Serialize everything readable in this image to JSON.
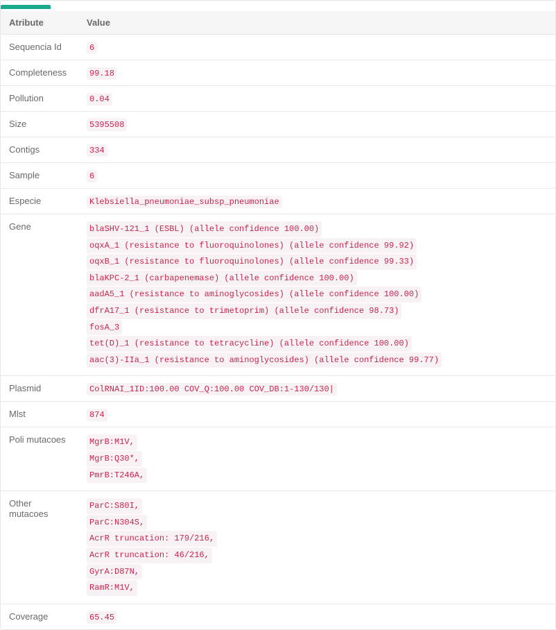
{
  "headers": {
    "attribute": "Atribute",
    "value": "Value"
  },
  "rows": [
    {
      "attr": "Sequencia Id",
      "values": [
        "6"
      ]
    },
    {
      "attr": "Completeness",
      "values": [
        "99.18"
      ]
    },
    {
      "attr": "Pollution",
      "values": [
        "0.04"
      ]
    },
    {
      "attr": "Size",
      "values": [
        "5395508"
      ]
    },
    {
      "attr": "Contigs",
      "values": [
        "334"
      ]
    },
    {
      "attr": "Sample",
      "values": [
        "6"
      ]
    },
    {
      "attr": "Especie",
      "values": [
        "Klebsiella_pneumoniae_subsp_pneumoniae"
      ]
    },
    {
      "attr": "Gene",
      "values": [
        "blaSHV-121_1 (ESBL) (allele confidence 100.00)",
        "oqxA_1 (resistance to fluoroquinolones) (allele confidence 99.92)",
        "oqxB_1 (resistance to fluoroquinolones) (allele confidence 99.33)",
        "blaKPC-2_1 (carbapenemase) (allele confidence 100.00)",
        "aadA5_1 (resistance to aminoglycosides) (allele confidence 100.00)",
        "dfrA17_1 (resistance to trimetoprim) (allele confidence 98.73)",
        "fosA_3",
        "tet(D)_1 (resistance to tetracycline) (allele confidence 100.00)",
        "aac(3)-IIa_1 (resistance to aminoglycosides) (allele confidence 99.77)"
      ]
    },
    {
      "attr": "Plasmid",
      "values": [
        "ColRNAI_1ID:100.00 COV_Q:100.00 COV_DB:1-130/130|"
      ]
    },
    {
      "attr": "Mlst",
      "values": [
        "874"
      ]
    },
    {
      "attr": "Poli mutacoes",
      "values": [
        "MgrB:M1V,",
        "MgrB:Q30*,",
        "PmrB:T246A,"
      ]
    },
    {
      "attr": "Other mutacoes",
      "values": [
        "ParC:S80I,",
        "ParC:N304S,",
        "AcrR truncation: 179/216,",
        "AcrR truncation: 46/216,",
        "GyrA:D87N,",
        "RamR:M1V,"
      ]
    },
    {
      "attr": "Coverage",
      "values": [
        "65.45"
      ]
    }
  ]
}
